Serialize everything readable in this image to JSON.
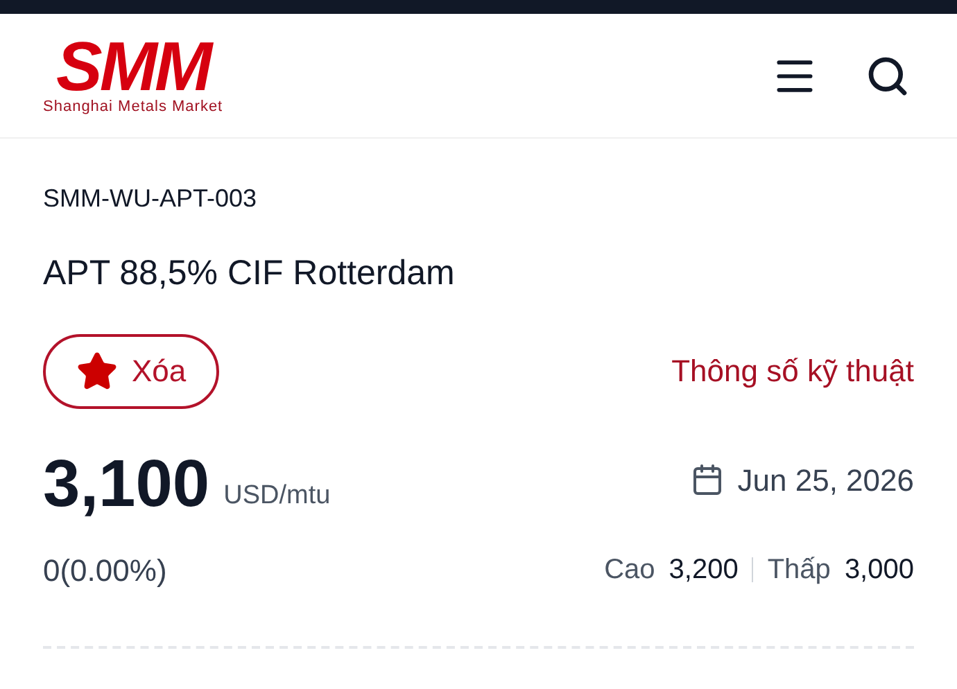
{
  "header": {
    "logo": "SMM",
    "tagline": "Shanghai Metals Market"
  },
  "product": {
    "code": "SMM-WU-APT-003",
    "title": "APT 88,5% CIF Rotterdam"
  },
  "favorite_button": {
    "label": "Xóa",
    "favorited": true
  },
  "specs_link": "Thông số kỹ thuật",
  "price": {
    "value": "3,100",
    "unit": "USD/mtu",
    "date": "Jun 25, 2026",
    "change": "0(0.00%)"
  },
  "range": [
    {
      "label": "Cao",
      "value": "3,200"
    },
    {
      "label": "Thấp",
      "value": "3,000"
    }
  ]
}
